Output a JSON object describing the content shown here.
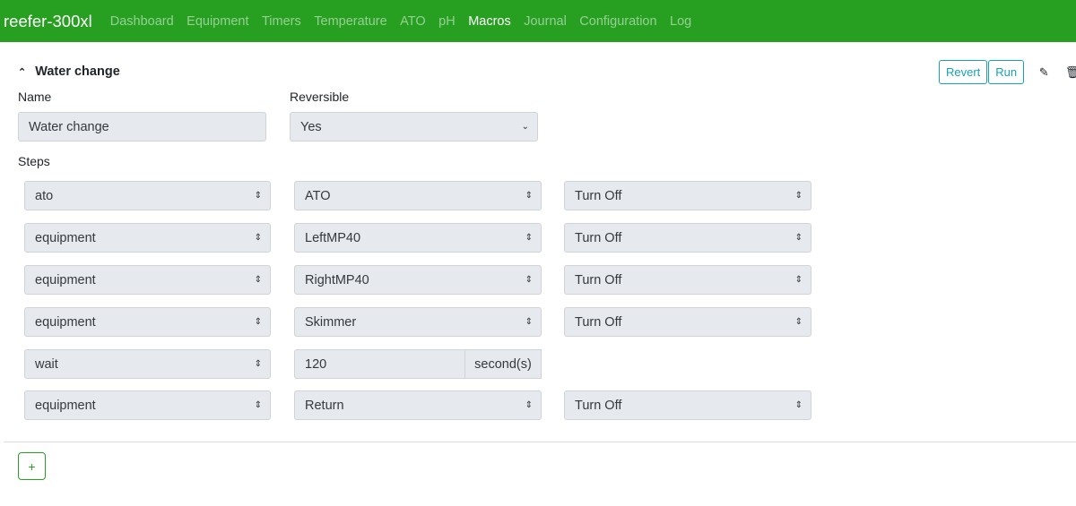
{
  "navbar": {
    "brand": "reefer-300xl",
    "items": [
      {
        "label": "Dashboard",
        "active": false
      },
      {
        "label": "Equipment",
        "active": false
      },
      {
        "label": "Timers",
        "active": false
      },
      {
        "label": "Temperature",
        "active": false
      },
      {
        "label": "ATO",
        "active": false
      },
      {
        "label": "pH",
        "active": false
      },
      {
        "label": "Macros",
        "active": true
      },
      {
        "label": "Journal",
        "active": false
      },
      {
        "label": "Configuration",
        "active": false
      },
      {
        "label": "Log",
        "active": false
      }
    ]
  },
  "macro": {
    "title": "Water change",
    "collapse_icon": "chevron-up-icon",
    "revert_label": "Revert",
    "run_label": "Run",
    "edit_icon": "edit-icon",
    "delete_icon": "trash-icon",
    "name_label": "Name",
    "name_value": "Water change",
    "reversible_label": "Reversible",
    "reversible_value": "Yes",
    "steps_label": "Steps",
    "steps": [
      {
        "type": "ato",
        "target": "ATO",
        "action": "Turn Off"
      },
      {
        "type": "equipment",
        "target": "LeftMP40",
        "action": "Turn Off"
      },
      {
        "type": "equipment",
        "target": "RightMP40",
        "action": "Turn Off"
      },
      {
        "type": "equipment",
        "target": "Skimmer",
        "action": "Turn Off"
      },
      {
        "type": "wait",
        "duration": "120",
        "unit": "second(s)"
      },
      {
        "type": "equipment",
        "target": "Return",
        "action": "Turn Off"
      }
    ],
    "add_step_label": "+"
  }
}
